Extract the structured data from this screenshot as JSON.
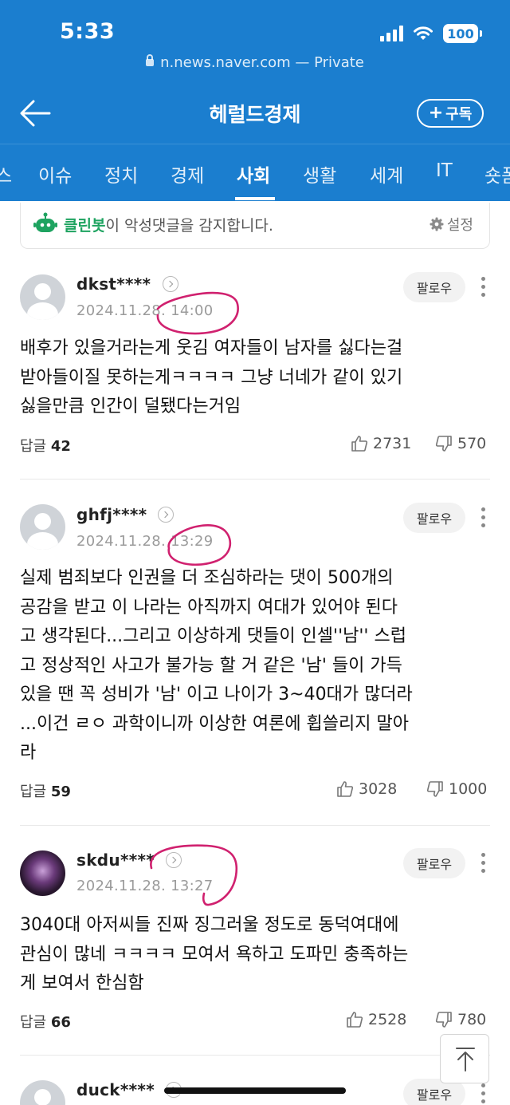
{
  "status_bar": {
    "time": "5:33",
    "battery": "100"
  },
  "url_bar": {
    "domain": "n.news.naver.com",
    "private_label": "— Private"
  },
  "header": {
    "title": "헤럴드경제",
    "subscribe_label": "구독"
  },
  "tabs": [
    "스",
    "이슈",
    "정치",
    "경제",
    "사회",
    "생활",
    "세계",
    "IT",
    "숏폼"
  ],
  "active_tab": "사회",
  "cleanbot": {
    "name": "클린봇",
    "message": "이 악성댓글을 감지합니다.",
    "settings_label": "설정"
  },
  "follow_label": "팔로우",
  "reply_label": "답글",
  "comments": [
    {
      "username": "dkst****",
      "date": "2024.11.28. 14:00",
      "lines": [
        "배후가 있을거라는게 웃김 여자들이 남자를 싫다는걸",
        "받아들이질 못하는게ㅋㅋㅋㅋ 그냥 너네가 같이 있기",
        "싫을만큼 인간이 덜됐다는거임"
      ],
      "replies": "42",
      "likes": "2731",
      "dislikes": "570"
    },
    {
      "username": "ghfj****",
      "date": "2024.11.28. 13:29",
      "lines": [
        "실제 범죄보다 인권을 더 조심하라는 댓이 500개의",
        "공감을 받고 이 나라는 아직까지 여대가 있어야 된다",
        "고 생각된다...그리고 이상하게 댓들이 인셀''남'' 스럽",
        "고 정상적인 사고가 불가능 할 거 같은 '남' 들이 가득",
        "있을 땐 꼭 성비가 '남' 이고 나이가 3~40대가 많더라",
        "...이건 ㄹㅇ 과학이니까 이상한 여론에 휩쓸리지 말아",
        "라"
      ],
      "replies": "59",
      "likes": "3028",
      "dislikes": "1000"
    },
    {
      "username": "skdu****",
      "date": "2024.11.28. 13:27",
      "lines": [
        "3040대 아저씨들 진짜 징그러울 정도로 동덕여대에",
        "관심이 많네 ㅋㅋㅋㅋ 모여서 욕하고 도파민 충족하는",
        "게 보여서 한심함"
      ],
      "replies": "66",
      "likes": "2528",
      "dislikes": "780"
    },
    {
      "username": "duck****"
    }
  ],
  "colors": {
    "header_blue": "#1b7ecf",
    "cleanbot_green": "#1ea360",
    "annotation_pink": "#d0216f"
  }
}
